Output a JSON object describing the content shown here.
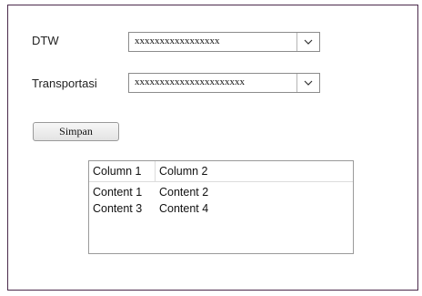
{
  "form": {
    "dtw_label": "DTW",
    "dtw_value": "xxxxxxxxxxxxxxxxx",
    "transport_label": "Transportasi",
    "transport_value": "xxxxxxxxxxxxxxxxxxxxxx",
    "save_label": "Simpan"
  },
  "table": {
    "headers": [
      "Column 1",
      "Column 2"
    ],
    "rows": [
      [
        "Content 1",
        "Content 2"
      ],
      [
        "Content 3",
        "Content 4"
      ]
    ]
  },
  "icons": {
    "dropdown": "chevron-down-icon"
  },
  "colors": {
    "frame_border": "#4b2a4b"
  }
}
